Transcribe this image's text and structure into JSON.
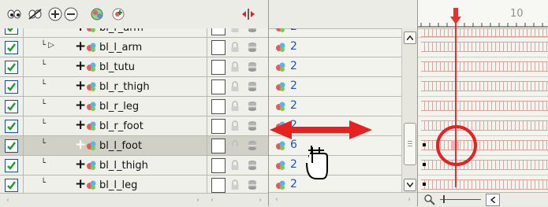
{
  "colors": {
    "accent": "#2050c0",
    "playhead": "#e83030",
    "annotation": "#e82020",
    "check": "#1c9c2c"
  },
  "toolbar": {
    "icons": [
      "show-all-icon",
      "hide-all-icon",
      "add-layer-icon",
      "remove-layer-icon",
      "peg-icon",
      "add-drawing-layer-icon",
      "collapse-columns-icon"
    ]
  },
  "layers": [
    {
      "name": "bl_r_arm",
      "tree": "└ ▷",
      "value": "2",
      "selected": false
    },
    {
      "name": "bl_l_arm",
      "tree": "└ ▷",
      "value": "2",
      "selected": false
    },
    {
      "name": "bl_tutu",
      "tree": "└",
      "value": "2",
      "selected": false
    },
    {
      "name": "bl_r_thigh",
      "tree": "└",
      "value": "2",
      "selected": false
    },
    {
      "name": "bl_r_leg",
      "tree": "└",
      "value": "2",
      "selected": false
    },
    {
      "name": "bl_r_foot",
      "tree": "└",
      "value": "2",
      "selected": false
    },
    {
      "name": "bl_l_foot",
      "tree": "└",
      "value": "6",
      "selected": true
    },
    {
      "name": "bl_l_thigh",
      "tree": "└",
      "value": "2",
      "selected": false
    },
    {
      "name": "bl_l_leg",
      "tree": "└",
      "value": "2",
      "selected": false
    }
  ],
  "timeline": {
    "ruler_label": "10"
  }
}
